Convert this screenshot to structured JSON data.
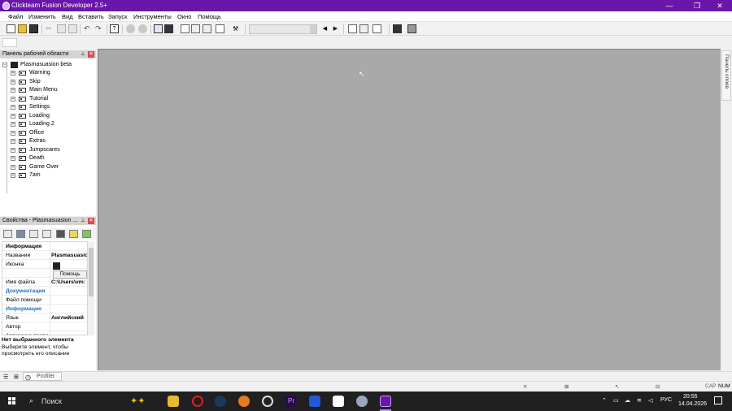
{
  "window": {
    "title": "Clickteam Fusion Developer 2.5+",
    "controls": [
      "—",
      "❐",
      "✕"
    ]
  },
  "menu": [
    "Файл",
    "Изменить",
    "Вид",
    "Вставить",
    "Запуск",
    "Инструменты",
    "Окно",
    "Помощь"
  ],
  "workspace": {
    "header": "Панель рабочей области",
    "root": "Plasmasuasion beta",
    "frames": [
      "Warning",
      "Skip",
      "Main Menu",
      "Tutorial",
      "Settings",
      "Loading",
      "Loading 2",
      "Office",
      "Extras",
      "Jumpscares",
      "Death",
      "Game Over",
      "7am"
    ]
  },
  "properties": {
    "header": "Свойства - Plasmasuasion ...",
    "rows": [
      {
        "k": "Информация",
        "v": "",
        "type": "section"
      },
      {
        "k": "Название",
        "v": "Plasmasuasio",
        "type": "row"
      },
      {
        "k": "Иконка",
        "v": "",
        "type": "row"
      },
      {
        "k": "",
        "v": "",
        "type": "row"
      },
      {
        "k": "Имя файла",
        "v": "C:\\Users\\vm:",
        "type": "row"
      },
      {
        "k": "Документация",
        "v": "",
        "type": "section-blue"
      },
      {
        "k": "Файл помощи",
        "v": "",
        "type": "row"
      },
      {
        "k": "Информация",
        "v": "",
        "type": "section-blue"
      },
      {
        "k": "Язык",
        "v": "Английский",
        "type": "row"
      },
      {
        "k": "Автор",
        "v": "",
        "type": "row"
      },
      {
        "k": "Авторские права",
        "v": "",
        "type": "row"
      }
    ],
    "help_button": "Помощь",
    "desc_title": "Нет выбранного элемента",
    "desc_text": "Выберите элемент, чтобы просмотреть его описание"
  },
  "editor": {
    "background": "#a9a9a9",
    "layers_tab": "Панель слоев"
  },
  "bottom_tabs": {
    "profiler": "Profiler"
  },
  "status": {
    "caps": "CAP",
    "num": "NUM"
  },
  "taskbar": {
    "search": "Поиск",
    "lang": "РУС",
    "time": "20:55",
    "date": "14.04.2026"
  },
  "colors": {
    "titlebar": "#6a16a8",
    "section_blue": "#1e6fc4"
  }
}
